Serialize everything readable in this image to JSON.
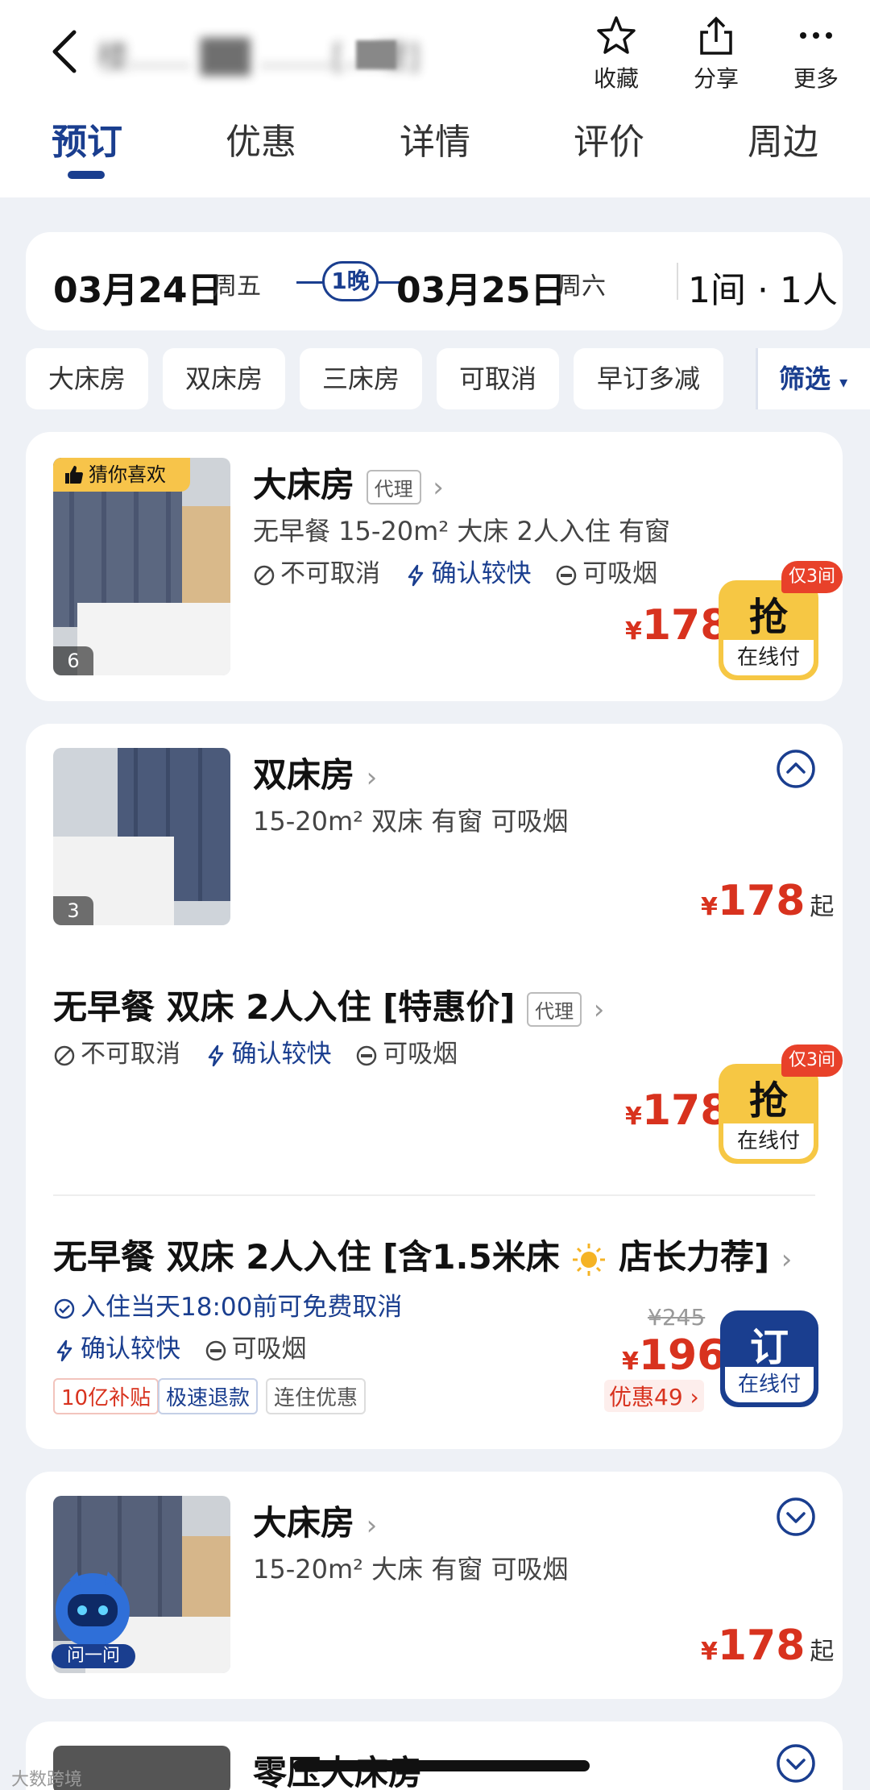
{
  "header": {
    "title": "楼......  ██  .......[...理]",
    "actions": [
      {
        "icon": "star-icon",
        "label": "收藏"
      },
      {
        "icon": "share-icon",
        "label": "分享"
      },
      {
        "icon": "more-icon",
        "label": "更多"
      }
    ]
  },
  "tabs": [
    "预订",
    "优惠",
    "详情",
    "评价",
    "周边"
  ],
  "stay": {
    "checkin_date": "03月24日",
    "checkin_weekday": "周五",
    "nights": "1晚",
    "checkout_date": "03月25日",
    "checkout_weekday": "周六",
    "guests": "1间 · 1人"
  },
  "filters": [
    "大床房",
    "双床房",
    "三床房",
    "可取消",
    "早订多减"
  ],
  "filter_button": "筛选",
  "room1": {
    "badge": "猜你喜欢",
    "photo_count": "6",
    "name": "大床房",
    "agent": "代理",
    "meta": "无早餐 15-20m² 大床 2人入住 有窗",
    "tag_no_cancel": "不可取消",
    "tag_fast": "确认较快",
    "tag_smoke": "可吸烟",
    "price_symbol": "¥",
    "price": "178",
    "only_left": "仅3间",
    "grab": "抢",
    "pay_online": "在线付"
  },
  "room2": {
    "photo_count": "3",
    "name": "双床房",
    "meta": "15-20m² 双床 有窗 可吸烟",
    "price_symbol": "¥",
    "price": "178",
    "price_suffix": "起"
  },
  "plan1": {
    "name": "无早餐 双床 2人入住 [特惠价]",
    "agent": "代理",
    "tag_no_cancel": "不可取消",
    "tag_fast": "确认较快",
    "tag_smoke": "可吸烟",
    "price_symbol": "¥",
    "price": "178",
    "only_left": "仅3间",
    "grab": "抢",
    "pay_online": "在线付"
  },
  "plan2": {
    "name_prefix": "无早餐 双床 2人入住 [含1.5米床",
    "name_suffix": "店长力荐]",
    "free_cancel": "入住当天18:00前可免费取消",
    "tag_fast": "确认较快",
    "tag_smoke": "可吸烟",
    "tags": [
      "10亿补贴",
      "极速退款",
      "连住优惠"
    ],
    "original_price": "¥245",
    "price_symbol": "¥",
    "price": "196",
    "discount": "优惠49 ›",
    "book": "订",
    "pay_online": "在线付"
  },
  "room3": {
    "name": "大床房",
    "meta": "15-20m² 大床 有窗 可吸烟",
    "price_symbol": "¥",
    "price": "178",
    "price_suffix": "起",
    "assistant_label": "问一问"
  },
  "room4": {
    "name": "零压大床房"
  },
  "watermark": "大数跨境",
  "colors": {
    "brand_blue": "#1a3e8f",
    "price_red": "#d8321e",
    "grab_yellow": "#f6c744",
    "background": "#eef1f6"
  }
}
